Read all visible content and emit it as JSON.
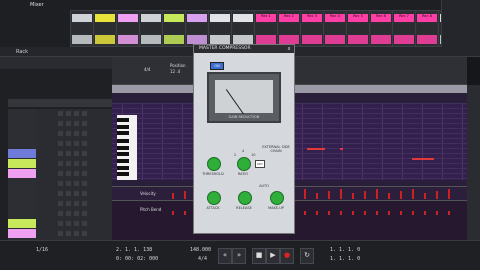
{
  "mixer": {
    "title": "Mixer",
    "channels": [
      {
        "label": "",
        "color": "#cfd2d6"
      },
      {
        "label": "",
        "color": "#e8e23a"
      },
      {
        "label": "",
        "color": "#f0a0f0"
      },
      {
        "label": "",
        "color": "#cfd2d6"
      },
      {
        "label": "",
        "color": "#c6e85a"
      },
      {
        "label": "",
        "color": "#d9a0f0"
      },
      {
        "label": "",
        "color": "#e1e3e6"
      },
      {
        "label": "",
        "color": "#e1e3e6"
      },
      {
        "label": "Rec 1",
        "color": "#ff3fa6"
      },
      {
        "label": "Rec 2",
        "color": "#ff3fa6"
      },
      {
        "label": "Rec 3",
        "color": "#ff3fa6"
      },
      {
        "label": "Rec 4",
        "color": "#ff3fa6"
      },
      {
        "label": "Rec 5",
        "color": "#ff3fa6"
      },
      {
        "label": "Rec 6",
        "color": "#ff3fa6"
      },
      {
        "label": "Rec 7",
        "color": "#ff3fa6"
      },
      {
        "label": "Rec 8",
        "color": "#ff3fa6"
      },
      {
        "label": "",
        "color": "#d9dcdf"
      },
      {
        "label": "",
        "color": "#d9dcdf"
      }
    ]
  },
  "rack": {
    "title": "Rack"
  },
  "sequencer": {
    "position_label": "Position",
    "position": "12 .4",
    "signature": "4/4"
  },
  "plugin": {
    "title": "MASTER COMPRESSOR",
    "close": "x",
    "on": "ON",
    "meter_label": "GAIN REDUCTION",
    "knobs": {
      "threshold": "THRESHOLD",
      "ratio": "RATIO",
      "attack": "ATTACK",
      "release": "RELEASE",
      "auto": "AUTO",
      "makeup": "MAKE-UP"
    },
    "ratio_values": [
      "2",
      "4",
      "10"
    ],
    "sidechain": "EXTERNAL SIDE CHAIN",
    "key": "KEY"
  },
  "lanes": {
    "velocity": "Velocity",
    "pitchbend": "Pitch Bend"
  },
  "transport": {
    "quantize": "1/16",
    "position": "2. 1. 1. 138",
    "time": "0: 00: 02: 000",
    "tempo": "148.000",
    "signature": "4/4",
    "loop_left": "1. 1. 1. 0",
    "loop_right": "1. 1. 1. 0"
  },
  "colors": {
    "pianoroll_bg": "#34204e",
    "knob": "#2fae3a",
    "record": "#cc2222"
  }
}
